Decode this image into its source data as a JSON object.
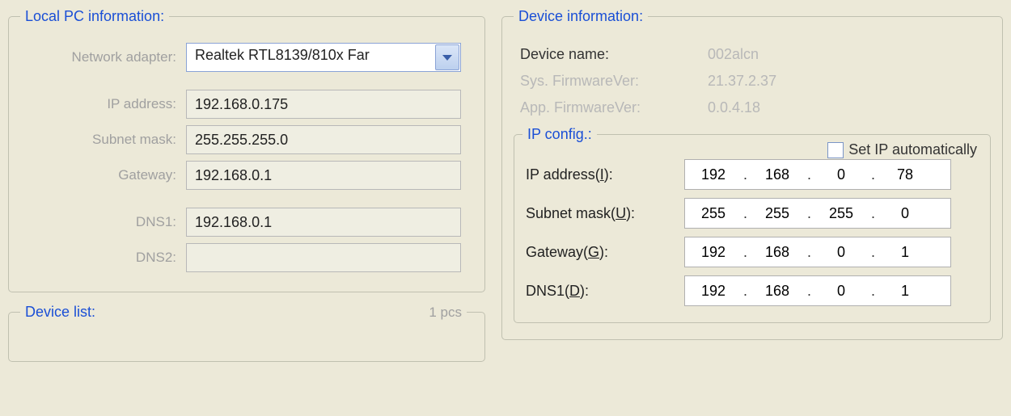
{
  "local_pc": {
    "title": "Local PC information:",
    "labels": {
      "adapter": "Network adapter:",
      "ip": "IP address:",
      "subnet": "Subnet mask:",
      "gateway": "Gateway:",
      "dns1": "DNS1:",
      "dns2": "DNS2:"
    },
    "adapter_value": "Realtek RTL8139/810x Far",
    "ip": "192.168.0.175",
    "subnet": "255.255.255.0",
    "gateway": "192.168.0.1",
    "dns1": "192.168.0.1",
    "dns2": ""
  },
  "device_list": {
    "title": "Device list:",
    "count_text": "1 pcs"
  },
  "device_info": {
    "title": "Device information:",
    "labels": {
      "name": "Device name:",
      "sysfw": "Sys. FirmwareVer:",
      "appfw": "App. FirmwareVer:"
    },
    "name": "002alcn",
    "sysfw": "21.37.2.37",
    "appfw": "0.0.4.18"
  },
  "ip_config": {
    "title": "IP config.:",
    "auto_label": "Set IP automatically",
    "auto_checked": false,
    "labels": {
      "ip_pre": "IP address(",
      "ip_mn": "I",
      "ip_post": "):",
      "subnet_pre": "Subnet mask(",
      "subnet_mn": "U",
      "subnet_post": "):",
      "gateway_pre": "Gateway(",
      "gateway_mn": "G",
      "gateway_post": "):",
      "dns1_pre": "DNS1(",
      "dns1_mn": "D",
      "dns1_post": "):"
    },
    "ip": [
      "192",
      "168",
      "0",
      "78"
    ],
    "subnet": [
      "255",
      "255",
      "255",
      "0"
    ],
    "gateway": [
      "192",
      "168",
      "0",
      "1"
    ],
    "dns1": [
      "192",
      "168",
      "0",
      "1"
    ]
  }
}
